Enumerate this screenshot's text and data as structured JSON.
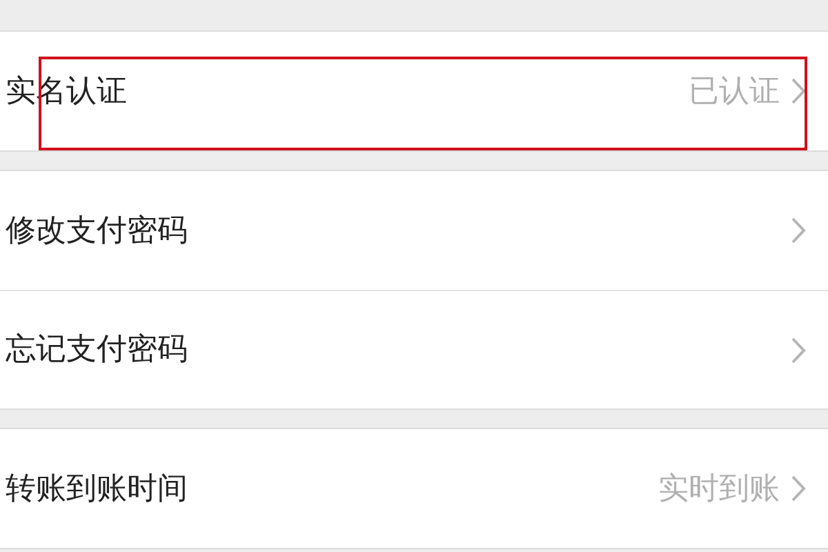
{
  "groups": [
    {
      "rows": [
        {
          "label": "实名认证",
          "value": "已认证",
          "highlighted": true
        }
      ]
    },
    {
      "rows": [
        {
          "label": "修改支付密码",
          "highlighted": false
        },
        {
          "label": "忘记支付密码",
          "highlighted": false
        }
      ]
    },
    {
      "rows": [
        {
          "label": "转账到账时间",
          "value": "实时到账",
          "highlighted": false
        }
      ]
    }
  ]
}
